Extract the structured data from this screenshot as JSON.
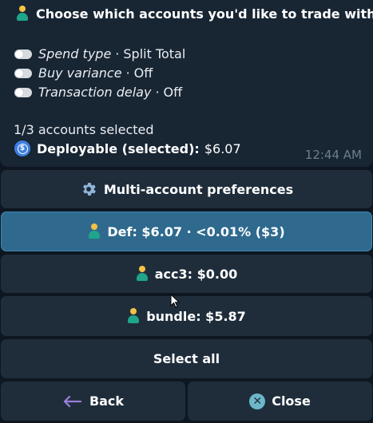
{
  "message": {
    "title": "Choose which accounts you'd like to trade with",
    "toggles": [
      {
        "label": "Spend type",
        "separator": "·",
        "value": "Split Total"
      },
      {
        "label": "Buy variance",
        "separator": "·",
        "value": "Off"
      },
      {
        "label": "Transaction delay",
        "separator": "·",
        "value": "Off"
      }
    ],
    "selected_count": "1/3 accounts selected",
    "deployable_label": "Deployable (selected):",
    "deployable_value": "$6.07",
    "timestamp": "12:44 AM"
  },
  "buttons": {
    "preferences": "Multi-account preferences",
    "accounts": [
      {
        "label": "Def: $6.07 · <0.01% ($3)",
        "selected": true
      },
      {
        "label": "acc3: $0.00",
        "selected": false
      },
      {
        "label": "bundle: $5.87",
        "selected": false
      }
    ],
    "select_all": "Select all",
    "back": "Back",
    "close": "Close"
  },
  "colors": {
    "background": "#0e1621",
    "bubble": "#182533",
    "button": "#1f2d3b",
    "button_selected": "#2f6a8e",
    "timestamp": "#6d7f8f"
  },
  "icons": {
    "title": "person-icon",
    "deployable": "dollar-coin-icon",
    "preferences": "gear-icon",
    "accounts": "person-icon",
    "back": "arrow-left-icon",
    "close": "close-circle-icon"
  }
}
